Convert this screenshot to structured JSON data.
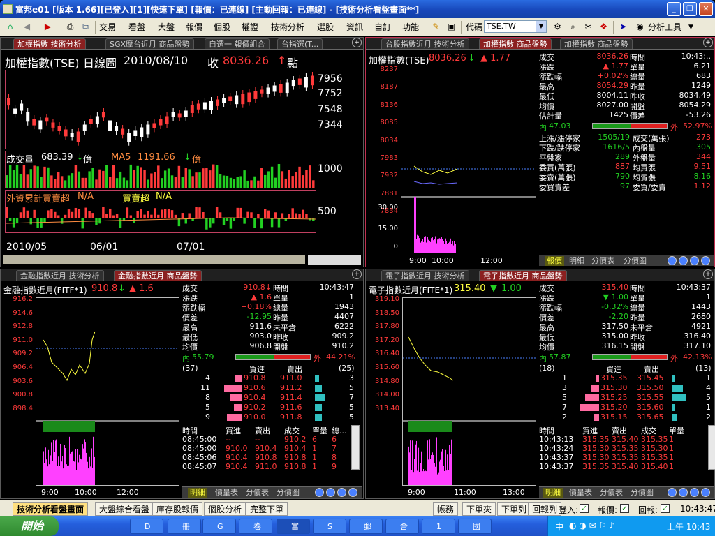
{
  "window": {
    "title": "富邦e01 [版本 1.66][已登入][1][快速下單] [報價：已連線] [主動回報：已連線] - [技術分析看盤畫面**]"
  },
  "menu": {
    "items": [
      "交易",
      "看盤",
      "大盤",
      "報價",
      "個股",
      "權證",
      "技術分析",
      "選股",
      "資訊",
      "自訂",
      "功能"
    ],
    "code_label": "代碼",
    "code_value": "TSE.TW",
    "analysis_tools": "分析工具"
  },
  "pane_tl": {
    "tabs": [
      "加權指數 技術分析",
      "SGX摩台近月 商品盤勢",
      "自選一 報價組合",
      "台指選(T..."
    ],
    "title": "加權指數(TSE)",
    "period": "日線圖",
    "date": "2010/08/10",
    "close_label": "收",
    "close": "8036.26",
    "arrow": "↑",
    "unit": "點",
    "yticks": [
      "7956",
      "7752",
      "7548",
      "7344"
    ],
    "vol_label": "成交量",
    "vol": "683.39",
    "vol_unit": "億",
    "ma5_label": "MA5",
    "ma5": "1191.66",
    "ma5_unit": "億",
    "vol_tick": "1000",
    "foreign_label": "外資累計買賣超",
    "foreign_val": "N/A",
    "netbuy_label": "買賣超",
    "netbuy_val": "N/A",
    "foreign_tick": "500",
    "xticks": [
      "2010/05",
      "06/01",
      "07/01"
    ]
  },
  "pane_tr": {
    "tabs": [
      "台股指數近月 技術分析",
      "加權指數 商品盤勢",
      "加權指數 商品盤勢"
    ],
    "title": "加權指數(TSE)",
    "price": "8036.26",
    "arrow": "↓",
    "change": "▲ 1.77",
    "yticks": [
      "8237",
      "8187",
      "8136",
      "8085",
      "8034",
      "7983",
      "7932",
      "7881",
      "7834"
    ],
    "vticks": [
      "30.00",
      "15.00",
      "0"
    ],
    "xticks": [
      "9:00",
      "10:00",
      "12:00"
    ],
    "quote": [
      {
        "k": "成交",
        "v": "8036.26",
        "k2": "時間",
        "v2": "10:43:.."
      },
      {
        "k": "漲跌",
        "v": "▲ 1.77",
        "k2": "單量",
        "v2": "6.21"
      },
      {
        "k": "漲跌幅",
        "v": "+0.02%",
        "k2": "總量",
        "v2": "683"
      },
      {
        "k": "最高",
        "v": "8054.29",
        "k2": "昨量",
        "v2": "1249"
      },
      {
        "k": "最低",
        "v": "8004.11",
        "k2": "昨收",
        "v2": "8034.49"
      },
      {
        "k": "均價",
        "v": "8027.00",
        "k2": "開盤",
        "v2": "8054.29"
      },
      {
        "k": "估計量",
        "v": "1425",
        "k2": "價差",
        "v2": "-53.26"
      }
    ],
    "inner_label": "內",
    "inner": "47.03",
    "outer_label": "外",
    "outer": "52.97%",
    "stats": [
      {
        "k": "上漲/漲停家",
        "v": "1505/19",
        "k2": "成交(萬張)",
        "v2": "273"
      },
      {
        "k": "下跌/跌停家",
        "v": "1616/5",
        "k2": "內盤量",
        "v2": "305"
      },
      {
        "k": "平盤家",
        "v": "289",
        "k2": "外盤量",
        "v2": "344"
      },
      {
        "k": "委買(萬張)",
        "v": "887",
        "k2": "均買張",
        "v2": "9.51"
      },
      {
        "k": "委賣(萬張)",
        "v": "790",
        "k2": "均賣張",
        "v2": "8.16"
      },
      {
        "k": "委買賣差",
        "v": "97",
        "k2": "委買/委賣",
        "v2": "1.12"
      }
    ],
    "bottom_tabs": [
      "報價",
      "明細",
      "分價表",
      "分價圖"
    ]
  },
  "pane_bl": {
    "tabs": [
      "金融指數近月 技術分析",
      "金融指數近月 商品盤勢"
    ],
    "title": "金融指數近月(FITF*1)",
    "price": "910.8",
    "arrow": "↓",
    "change": "▲ 1.6",
    "yticks": [
      "916.2",
      "914.6",
      "912.8",
      "911.0",
      "909.2",
      "906.4",
      "903.6",
      "900.8",
      "898.4"
    ],
    "xticks": [
      "9:00",
      "10:00",
      "12:00"
    ],
    "quote": [
      {
        "k": "成交",
        "v": "910.8↓",
        "k2": "時間",
        "v2": "10:43:47"
      },
      {
        "k": "漲跌",
        "v": "▲ 1.6",
        "k2": "單量",
        "v2": "1"
      },
      {
        "k": "漲跌幅",
        "v": "+0.18%",
        "k2": "總量",
        "v2": "1943"
      },
      {
        "k": "價差",
        "v": "-12.95",
        "k2": "昨量",
        "v2": "4407"
      },
      {
        "k": "最高",
        "v": "911.6",
        "k2": "未平倉",
        "v2": "6222"
      },
      {
        "k": "最低",
        "v": "903.0",
        "k2": "昨收",
        "v2": "909.2"
      },
      {
        "k": "均價",
        "v": "906.8",
        "k2": "開盤",
        "v2": "910.2"
      }
    ],
    "inner_label": "內",
    "inner": "55.79",
    "outer_label": "外",
    "outer": "44.21%",
    "bid_count": "(37)",
    "ask_count": "(25)",
    "bid_h": "買進",
    "ask_h": "賣出",
    "book": [
      {
        "bq": "4",
        "bp": "910.8",
        "ap": "911.0",
        "aq": "3",
        "bw": 0.25,
        "aw": 0.15
      },
      {
        "bq": "11",
        "bp": "910.6",
        "ap": "911.2",
        "aq": "5",
        "bw": 0.65,
        "aw": 0.25
      },
      {
        "bq": "8",
        "bp": "910.4",
        "ap": "911.4",
        "aq": "7",
        "bw": 0.45,
        "aw": 0.35
      },
      {
        "bq": "5",
        "bp": "910.2",
        "ap": "911.6",
        "aq": "5",
        "bw": 0.3,
        "aw": 0.25
      },
      {
        "bq": "9",
        "bp": "910.0",
        "ap": "911.8",
        "aq": "5",
        "bw": 0.55,
        "aw": 0.25
      }
    ],
    "ticks_head": [
      "時間",
      "買進",
      "賣出",
      "成交",
      "單量",
      "總..."
    ],
    "ticks": [
      [
        "08:45:00",
        "--",
        "--",
        "910.2",
        "6",
        "6"
      ],
      [
        "08:45:00",
        "910.0",
        "910.4",
        "910.4",
        "1",
        "7"
      ],
      [
        "08:45:06",
        "910.4",
        "910.8",
        "910.8",
        "1",
        "8"
      ],
      [
        "08:45:07",
        "910.4",
        "911.0",
        "910.8",
        "1",
        "9"
      ]
    ],
    "bottom_tabs": [
      "明細",
      "價量表",
      "分價表",
      "分價圖"
    ]
  },
  "pane_br": {
    "tabs": [
      "電子指數近月 技術分析",
      "電子指數近月 商品盤勢"
    ],
    "title": "電子指數近月(FITE*1)",
    "price": "315.40",
    "arrow": "▼",
    "change": "1.00",
    "yticks": [
      "319.10",
      "318.50",
      "317.80",
      "317.20",
      "316.40",
      "315.60",
      "314.80",
      "314.00",
      "313.40"
    ],
    "xticks": [
      "9:00",
      "11:00",
      "13:00"
    ],
    "quote": [
      {
        "k": "成交",
        "v": "315.40",
        "k2": "時間",
        "v2": "10:43:37"
      },
      {
        "k": "漲跌",
        "v": "▼ 1.00",
        "k2": "單量",
        "v2": "1"
      },
      {
        "k": "漲跌幅",
        "v": "-0.32%",
        "k2": "總量",
        "v2": "1443"
      },
      {
        "k": "價差",
        "v": "-2.20",
        "k2": "昨量",
        "v2": "2680"
      },
      {
        "k": "最高",
        "v": "317.50",
        "k2": "未平倉",
        "v2": "4921"
      },
      {
        "k": "最低",
        "v": "315.00",
        "k2": "昨收",
        "v2": "316.40"
      },
      {
        "k": "均價",
        "v": "316.15",
        "k2": "開盤",
        "v2": "317.10"
      }
    ],
    "inner_label": "內",
    "inner": "57.87",
    "outer_label": "外",
    "outer": "42.13%",
    "bid_count": "(18)",
    "ask_count": "(13)",
    "bid_h": "買進",
    "ask_h": "賣出",
    "book": [
      {
        "bq": "1",
        "bp": "315.35",
        "ap": "315.45",
        "aq": "1",
        "bw": 0.1,
        "aw": 0.1
      },
      {
        "bq": "3",
        "bp": "315.30",
        "ap": "315.50",
        "aq": "4",
        "bw": 0.3,
        "aw": 0.4
      },
      {
        "bq": "5",
        "bp": "315.25",
        "ap": "315.55",
        "aq": "5",
        "bw": 0.5,
        "aw": 0.5
      },
      {
        "bq": "7",
        "bp": "315.20",
        "ap": "315.60",
        "aq": "1",
        "bw": 0.7,
        "aw": 0.1
      },
      {
        "bq": "2",
        "bp": "315.15",
        "ap": "315.65",
        "aq": "2",
        "bw": 0.2,
        "aw": 0.2
      }
    ],
    "ticks_head": [
      "時間",
      "買進",
      "賣出",
      "成交",
      "單量"
    ],
    "ticks": [
      [
        "10:43:13",
        "315.35",
        "315.40",
        "315.35",
        "1"
      ],
      [
        "10:43:24",
        "315.30",
        "315.35",
        "315.30",
        "1"
      ],
      [
        "10:43:37",
        "315.30",
        "315.35",
        "315.35",
        "1"
      ],
      [
        "10:43:37",
        "315.35",
        "315.40",
        "315.40",
        "1"
      ]
    ],
    "bottom_tabs": [
      "明細",
      "價量表",
      "分價表",
      "分價圖"
    ]
  },
  "bottombar": {
    "tabs": [
      "技術分析看盤畫面",
      "大盤綜合看盤",
      "庫存股報價",
      "個股分析",
      "完整下單"
    ],
    "right": [
      "帳務",
      "下單夾",
      "下單列",
      "回報列"
    ],
    "login": "登入:",
    "quote": "報價:",
    "report": "回報:",
    "time": "10:43:47"
  },
  "taskbar": {
    "start": "開始",
    "items": [
      "D",
      "G",
      "冊",
      "卷",
      "富",
      "S",
      "郵",
      "舍",
      "1",
      "國"
    ],
    "clock": "上午 10:43",
    "lang": "中"
  }
}
